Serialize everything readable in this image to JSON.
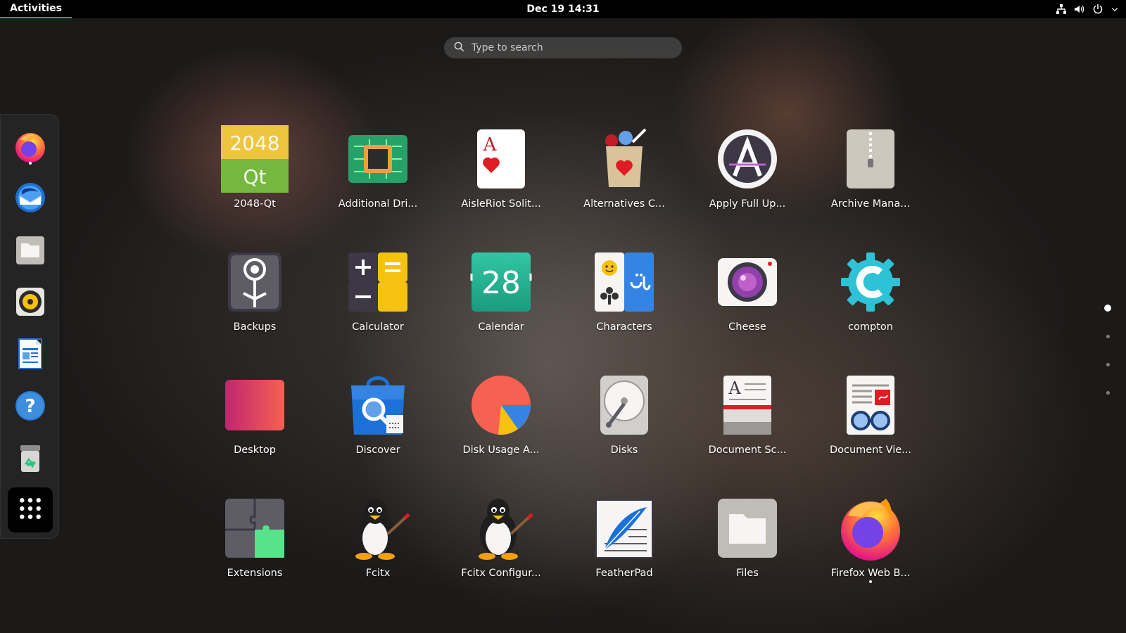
{
  "topbar": {
    "activities": "Activities",
    "clock": "Dec 19  14:31",
    "icons": [
      "network-icon",
      "volume-icon",
      "power-icon",
      "chevron-down-icon"
    ]
  },
  "search": {
    "placeholder": "Type to search"
  },
  "dash": {
    "items": [
      {
        "name": "Firefox",
        "icon": "firefox-icon",
        "running": true
      },
      {
        "name": "Thunderbird",
        "icon": "thunderbird-icon",
        "running": false
      },
      {
        "name": "Files",
        "icon": "files-icon",
        "running": false
      },
      {
        "name": "Rhythmbox",
        "icon": "rhythmbox-icon",
        "running": false
      },
      {
        "name": "LibreOffice Writer",
        "icon": "writer-icon",
        "running": false
      },
      {
        "name": "Help",
        "icon": "help-icon",
        "running": false
      },
      {
        "name": "Trash",
        "icon": "trash-icon",
        "running": false
      }
    ],
    "show_apps_icon": "app-grid-icon"
  },
  "apps": [
    {
      "label": "2048-Qt",
      "icon": "2048-qt-icon"
    },
    {
      "label": "Additional Dri...",
      "icon": "chip-icon"
    },
    {
      "label": "AisleRiot Solit...",
      "icon": "playing-card-icon"
    },
    {
      "label": "Alternatives C...",
      "icon": "grocery-bag-icon"
    },
    {
      "label": "Apply Full Up...",
      "icon": "software-updater-icon"
    },
    {
      "label": "Archive Mana...",
      "icon": "archive-icon"
    },
    {
      "label": "Backups",
      "icon": "backups-icon"
    },
    {
      "label": "Calculator",
      "icon": "calculator-icon"
    },
    {
      "label": "Calendar",
      "icon": "calendar-icon",
      "calendar_day": "28"
    },
    {
      "label": "Characters",
      "icon": "characters-icon"
    },
    {
      "label": "Cheese",
      "icon": "webcam-icon"
    },
    {
      "label": "compton",
      "icon": "gear-icon"
    },
    {
      "label": "Desktop",
      "icon": "desktop-icon"
    },
    {
      "label": "Discover",
      "icon": "shopping-bag-icon"
    },
    {
      "label": "Disk Usage A...",
      "icon": "pie-chart-icon"
    },
    {
      "label": "Disks",
      "icon": "disk-icon"
    },
    {
      "label": "Document Sc...",
      "icon": "scanner-icon"
    },
    {
      "label": "Document Vie...",
      "icon": "document-viewer-icon"
    },
    {
      "label": "Extensions",
      "icon": "puzzle-icon"
    },
    {
      "label": "Fcitx",
      "icon": "penguin-icon"
    },
    {
      "label": "Fcitx Configur...",
      "icon": "penguin-icon"
    },
    {
      "label": "FeatherPad",
      "icon": "notepad-feather-icon"
    },
    {
      "label": "Files",
      "icon": "folder-icon"
    },
    {
      "label": "Firefox Web B...",
      "icon": "firefox-icon",
      "running": true
    }
  ],
  "pager": {
    "pages": 4,
    "current": 1
  }
}
